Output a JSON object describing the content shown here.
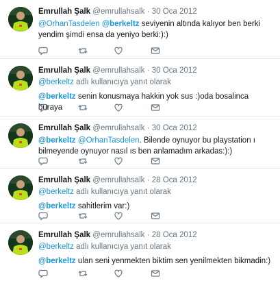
{
  "colors": {
    "link": "#1b95e0",
    "muted": "#657786",
    "text": "#14171a",
    "divider": "#e6ecf0"
  },
  "icons": {
    "reply": "reply-icon",
    "retweet": "retweet-icon",
    "like": "heart-icon",
    "message": "envelope-icon"
  },
  "tweets": [
    {
      "name": "Emrullah Şalk",
      "handle": "@emrullahsalk",
      "dot": "·",
      "time": "30 Oca 2012",
      "mention1": "@OrhanTasdelen",
      "mention2": "@berkeltz",
      "text_a": " seviyenin altında kalıyor ben berki yendim şimdi ensa da yeniyo berki:):)"
    },
    {
      "name": "Emrullah Şalk",
      "handle": "@emrullahsalk",
      "dot": "·",
      "time": "30 Oca 2012",
      "reply_mention": "@berkeltz",
      "reply_suffix": " adlı kullanıcıya yanıt olarak",
      "mention": "@berkeltz",
      "text_a": " senin konusmaya hakkin yok sus :)oda bosalinca buraya"
    },
    {
      "name": "Emrullah Şalk",
      "handle": "@emrullahsalk",
      "dot": "·",
      "time": "30 Oca 2012",
      "mention1": "@berkeltz",
      "mention2": "@OrhanTasdelen",
      "text_a": ". Bilende oynuyor bu playstation ı bilmeyende oynuyor nasıl ıs ben anlamadım arkadas:):)"
    },
    {
      "name": "Emrullah Şalk",
      "handle": "@emrullahsalk",
      "dot": "·",
      "time": "28 Oca 2012",
      "reply_mention": "@berkeltz",
      "reply_suffix": " adlı kullanıcıya yanıt olarak",
      "mention": "@berkeltz",
      "text_a": " sahitlerim var:)"
    },
    {
      "name": "Emrullah Şalk",
      "handle": "@emrullahsalk",
      "dot": "·",
      "time": "28 Oca 2012",
      "reply_mention": "@berkeltz",
      "reply_suffix": " adlı kullanıcıya yanıt olarak",
      "mention": "@berkeltz",
      "text_a": " ulan seni yenmekten biktim sen yenilmekten bikmadin:)"
    }
  ]
}
